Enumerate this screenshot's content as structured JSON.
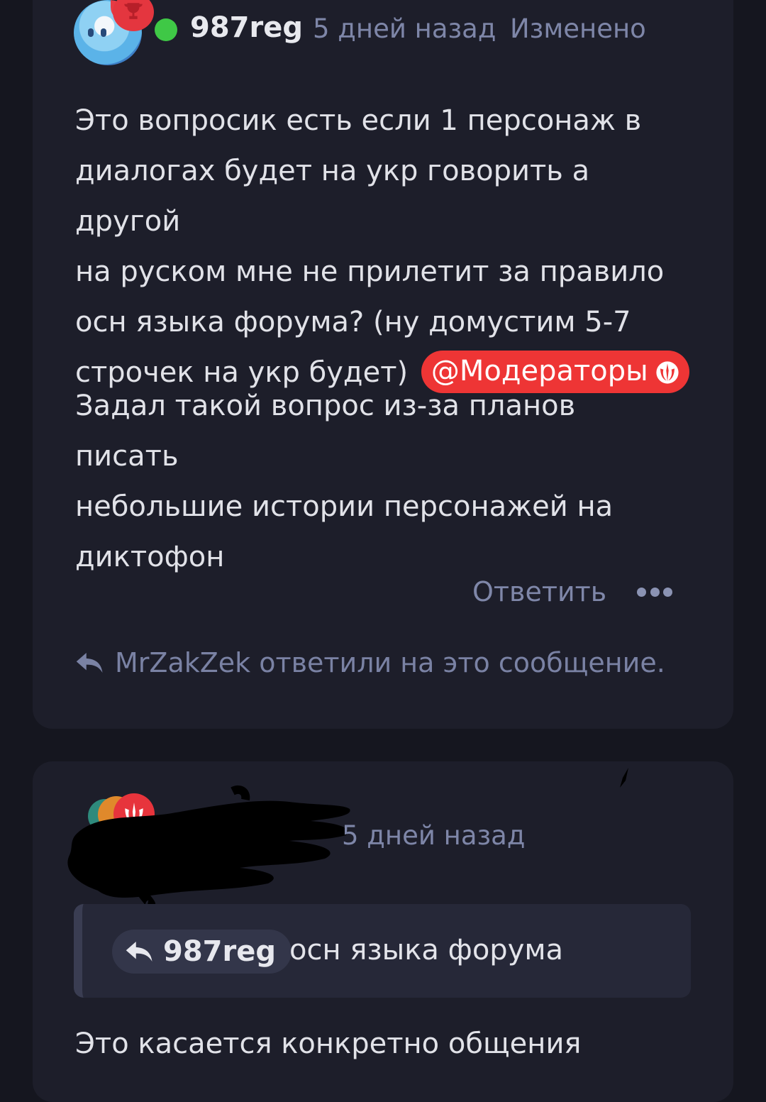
{
  "post1": {
    "username": "987reg",
    "time": "5 дней назад",
    "edited": "Изменено",
    "line1": "Это вопросик есть если 1 персонаж в",
    "line2": "диалогах будет на укр говорить а другой",
    "line3": "на руском мне не прилетит за правило",
    "line4": "осн языка форума? (ну домустим 5-7",
    "line5": "строчек на укр будет)",
    "mention": "@Модераторы",
    "para2_line1": "Задал такой вопрос из-за планов писать",
    "para2_line2": "небольшие истории персонажей на",
    "para2_line3": "диктофон",
    "reply_label": "Ответить",
    "replied_note": "MrZakZek ответили на это сообщение."
  },
  "post2": {
    "time": "5 дней назад",
    "quote_author": "987reg",
    "quote_text": "осн языка форума",
    "line1": "Это касается конкретно общения"
  },
  "colors": {
    "background": "#15161f",
    "card": "#1d1e2a",
    "mention_bg": "#ee3535",
    "online": "#3fc846",
    "muted_text": "#7e86a8"
  },
  "icons": [
    "trophy-icon",
    "jedi-order-icon",
    "more-dots-icon",
    "reply-arrow-icon"
  ]
}
